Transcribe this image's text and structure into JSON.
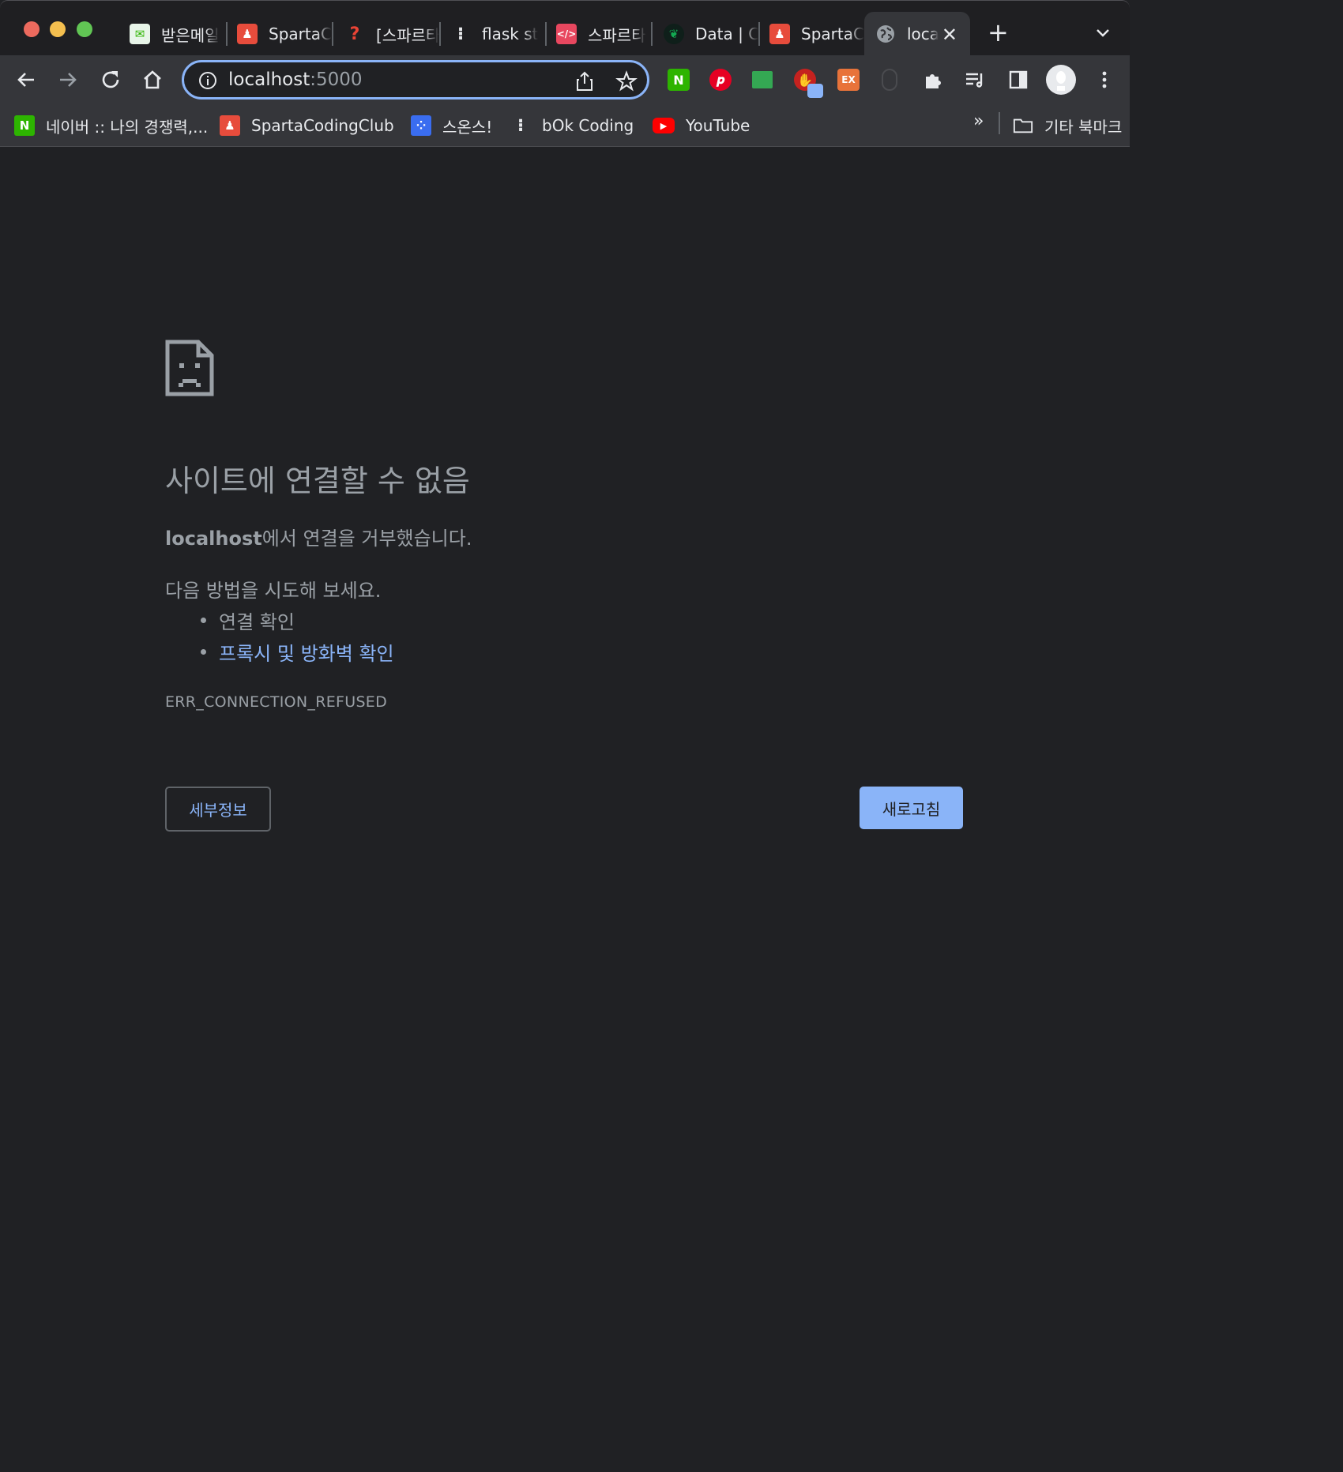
{
  "window": {
    "tabs": [
      {
        "label": "받은메일",
        "favicon": "mail-icon",
        "color": "#e8f5e9"
      },
      {
        "label": "SpartaC",
        "favicon": "sparta-icon",
        "color": "#e74c3c"
      },
      {
        "label": "[스파르타",
        "favicon": "question-icon",
        "color": "#ea4335"
      },
      {
        "label": "flask st",
        "favicon": "dots-icon",
        "color": "#202124"
      },
      {
        "label": "스파르타",
        "favicon": "code-heart-icon",
        "color": "#e8475f"
      },
      {
        "label": "Data | C",
        "favicon": "leaf-icon",
        "color": "#0f1f1a"
      },
      {
        "label": "SpartaC",
        "favicon": "sparta-icon",
        "color": "#e74c3c"
      },
      {
        "label": "loca",
        "favicon": "globe-icon",
        "active": true
      }
    ]
  },
  "toolbar": {
    "url_host": "localhost",
    "url_port": ":5000",
    "extensions": [
      {
        "name": "naver-icon",
        "text": "N",
        "color": "#2db400"
      },
      {
        "name": "pinterest-icon",
        "text": "P",
        "color": "#e60023"
      },
      {
        "name": "screen-icon",
        "text": "",
        "color": "#34a853"
      },
      {
        "name": "hand-stop-icon",
        "text": "",
        "color": "#c5221f"
      },
      {
        "name": "ex-icon",
        "text": "EX",
        "color": "#e8733a"
      }
    ]
  },
  "bookmarks": [
    {
      "label": "네이버 :: 나의 경쟁력,...",
      "icon": "naver-icon",
      "color": "#2db400",
      "glyph": "N"
    },
    {
      "label": "SpartaCodingClub",
      "icon": "sparta-icon",
      "color": "#e74c3c",
      "glyph": "♟"
    },
    {
      "label": "스온스!",
      "icon": "app-icon",
      "color": "#3a6df0",
      "glyph": "⁘"
    },
    {
      "label": "bOk Coding",
      "icon": "dots-icon",
      "color": "#35363a",
      "glyph": "⁝"
    },
    {
      "label": "YouTube",
      "icon": "youtube-icon",
      "color": "#ff0000",
      "glyph": "▶"
    }
  ],
  "bookmarks_more": "»",
  "other_bookmarks": "기타 북마크",
  "error": {
    "title": "사이트에 연결할 수 없음",
    "host": "localhost",
    "message_suffix": "에서 연결을 거부했습니다.",
    "try_label": "다음 방법을 시도해 보세요.",
    "suggestions": [
      "연결 확인",
      "프록시 및 방화벽 확인"
    ],
    "code": "ERR_CONNECTION_REFUSED",
    "details_button": "세부정보",
    "reload_button": "새로고침"
  }
}
